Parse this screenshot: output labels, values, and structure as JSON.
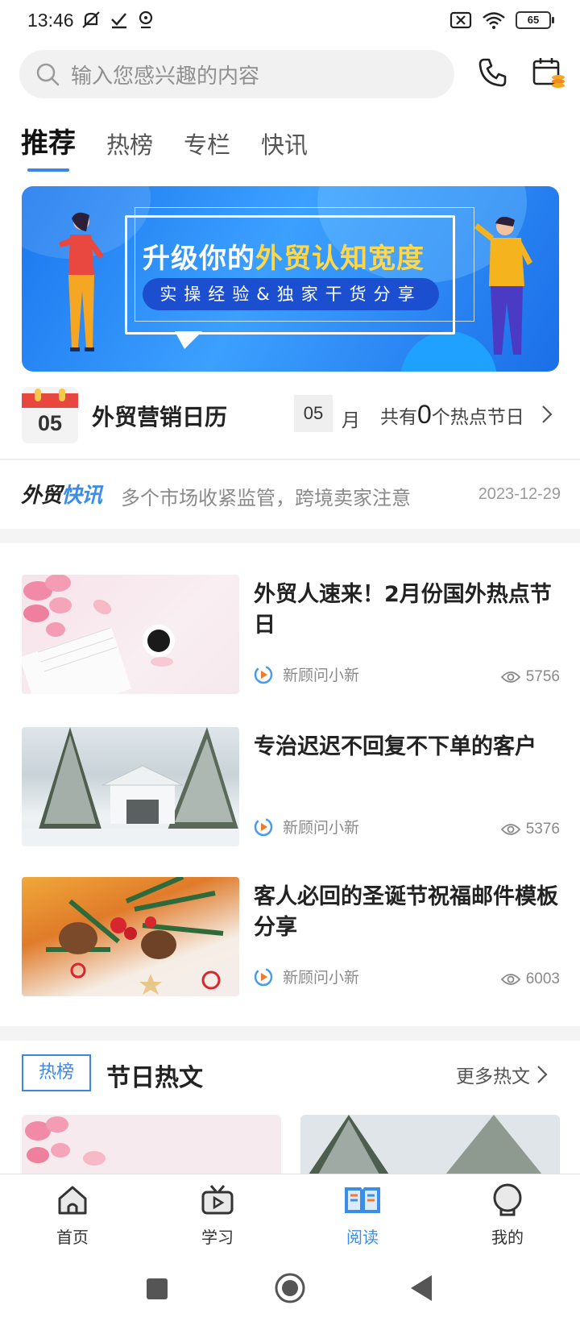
{
  "status_bar": {
    "time": "13:46",
    "battery": "65"
  },
  "search": {
    "placeholder": "输入您感兴趣的内容"
  },
  "tabs": [
    {
      "label": "推荐",
      "active": true
    },
    {
      "label": "热榜",
      "active": false
    },
    {
      "label": "专栏",
      "active": false
    },
    {
      "label": "快讯",
      "active": false
    }
  ],
  "banner": {
    "title_prefix": "升级你的",
    "title_highlight": "外贸认知宽度",
    "subtitle": "实操经验&独家干货分享"
  },
  "calendar": {
    "icon_day": "05",
    "title": "外贸营销日历",
    "month_value": "05",
    "month_unit": "月",
    "count_prefix": "共有",
    "count_value": "0",
    "count_suffix": "个热点节日"
  },
  "flash": {
    "brand_a": "外贸",
    "brand_b": "快讯",
    "headline": "多个市场收紧监管，跨境卖家注意",
    "date": "2023-12-29"
  },
  "articles": [
    {
      "title": "外贸人速来！2月份国外热点节日",
      "author": "新顾问小新",
      "views": "5756"
    },
    {
      "title": "专治迟迟不回复不下单的客户",
      "author": "新顾问小新",
      "views": "5376"
    },
    {
      "title": "客人必回的圣诞节祝福邮件模板分享",
      "author": "新顾问小新",
      "views": "6003"
    }
  ],
  "hot_section": {
    "tag": "热榜",
    "title": "节日热文",
    "more": "更多热文"
  },
  "bottom_nav": [
    {
      "label": "首页",
      "icon": "home-icon",
      "active": false
    },
    {
      "label": "学习",
      "icon": "tv-icon",
      "active": false
    },
    {
      "label": "阅读",
      "icon": "book-icon",
      "active": true
    },
    {
      "label": "我的",
      "icon": "profile-icon",
      "active": false
    }
  ],
  "colors": {
    "accent": "#3a8de8",
    "banner_highlight": "#ffd84a",
    "calendar_red": "#e8473f"
  }
}
